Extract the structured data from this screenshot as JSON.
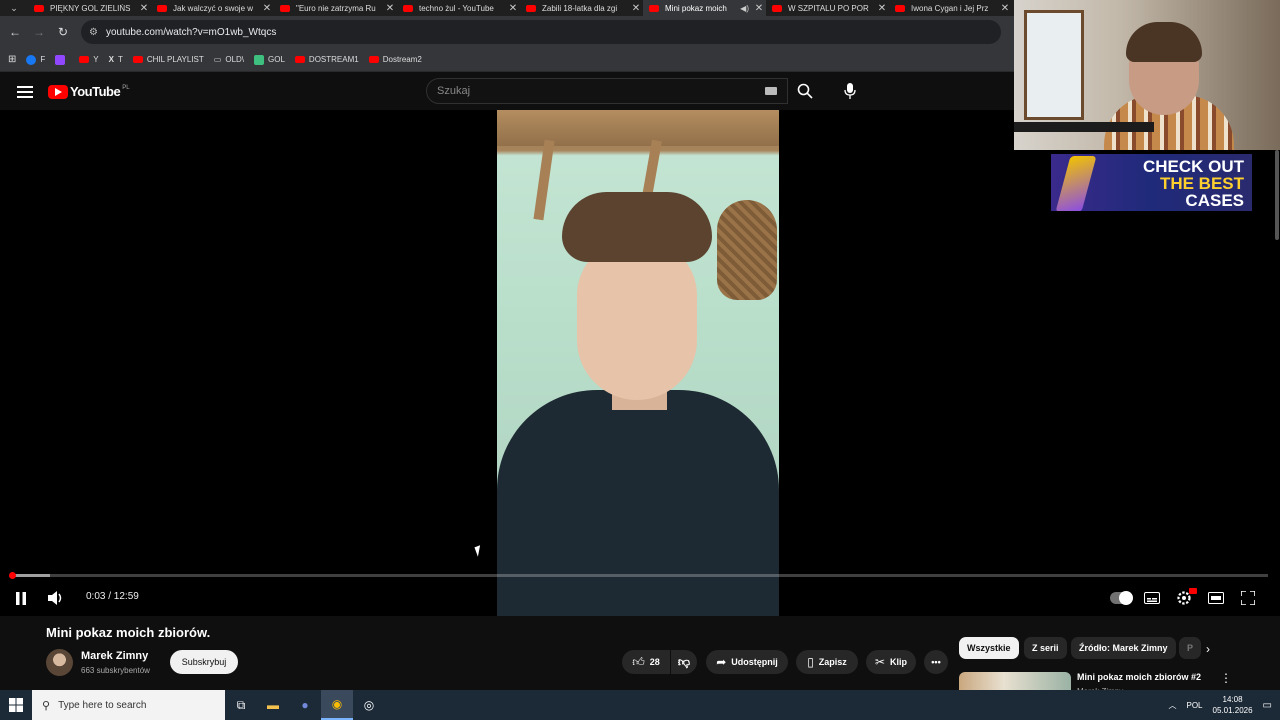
{
  "browser": {
    "tabs": [
      {
        "title": "PIĘKNY GOL ZIELIŃS",
        "active": false
      },
      {
        "title": "Jak walczyć o swoje w",
        "active": false
      },
      {
        "title": "\"Euro nie zatrzyma Ru",
        "active": false
      },
      {
        "title": "techno żul - YouTube",
        "active": false
      },
      {
        "title": "Zabili 18-latka dla zgi",
        "active": false
      },
      {
        "title": "Mini pokaz moich",
        "active": true
      },
      {
        "title": "W SZPITALU PO POR",
        "active": false
      },
      {
        "title": "Iwona Cygan i Jej Prz",
        "active": false
      }
    ],
    "url": "youtube.com/watch?v=mO1wb_Wtqcs",
    "bookmarks": [
      {
        "label": "F",
        "color": "#1877f2"
      },
      {
        "label": "",
        "color": "#9146ff"
      },
      {
        "label": "Y",
        "color": "#ff0000"
      },
      {
        "label": "T",
        "color": "#ffffff"
      },
      {
        "label": "CHIL PLAYLIST",
        "color": "#ff0000"
      },
      {
        "label": "OLD\\",
        "color": "#cccccc"
      },
      {
        "label": "GOL",
        "color": "#3fbf7f"
      },
      {
        "label": "DOSTREAM1",
        "color": "#ff0000"
      },
      {
        "label": "Dostream2",
        "color": "#ff0000"
      }
    ]
  },
  "youtube": {
    "logo_text": "YouTube",
    "country_code": "PL",
    "search_placeholder": "Szukaj"
  },
  "player": {
    "time": "0:03 / 12:59",
    "progress": 0.004,
    "buffered": 0.03
  },
  "overlay": {
    "promo_line1": "CHECK OUT",
    "promo_line2": "THE BEST",
    "promo_line3": "CASES"
  },
  "video": {
    "title": "Mini pokaz moich zbiorów.",
    "channel": "Marek Zimny",
    "subscribers": "663 subskrybentów",
    "subscribe_label": "Subskrybuj",
    "likes": "28",
    "share_label": "Udostępnij",
    "save_label": "Zapisz",
    "clip_label": "Klip"
  },
  "sidebar": {
    "chips": [
      "Wszystkie",
      "Z serii",
      "Źródło: Marek Zimny",
      "P"
    ],
    "rec_title": "Mini pokaz moich zbiorów #2",
    "rec_channel": "Marek Zimny"
  },
  "taskbar": {
    "search_placeholder": "Type here to search",
    "language": "POL",
    "time": "14:08",
    "date": "05.01.2026"
  }
}
